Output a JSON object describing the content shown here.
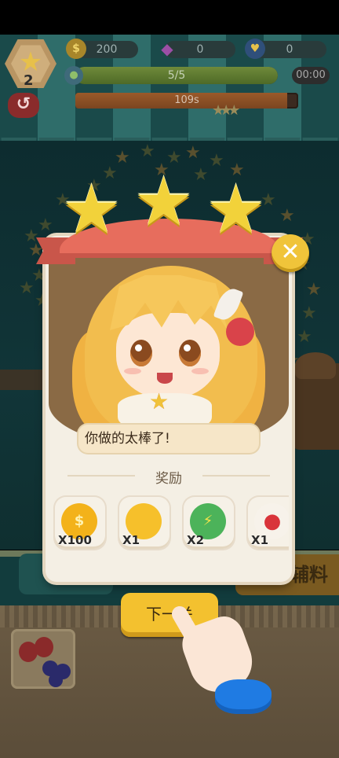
{
  "hud": {
    "level": "2",
    "coins": "200",
    "gems": "0",
    "hearts": "0",
    "orders_progress": "5/5",
    "orders_fraction": 1.0,
    "clock": "00:00",
    "time_remaining": "109s",
    "time_fraction": 0.95
  },
  "reward_popup": {
    "stars_earned": 3,
    "dialog_text": "你做的太棒了!",
    "rewards_title": "奖励",
    "rewards": [
      {
        "icon": "coin-icon",
        "quantity": "X100",
        "color": "#f3b21a"
      },
      {
        "icon": "lemon-scoop-icon",
        "quantity": "X1",
        "color": "#f6c02b"
      },
      {
        "icon": "lightning-leaf-icon",
        "quantity": "X2",
        "color": "#4cb35a"
      },
      {
        "icon": "cherry-cream-icon",
        "quantity": "X1",
        "color": "#d9343a"
      }
    ],
    "next_button_label": "下一关"
  },
  "background": {
    "ingredients_label": "辅料"
  },
  "colors": {
    "accent_yellow": "#f3c12f",
    "ribbon_red": "#e76d5d",
    "panel_cream": "#f4efe4"
  }
}
